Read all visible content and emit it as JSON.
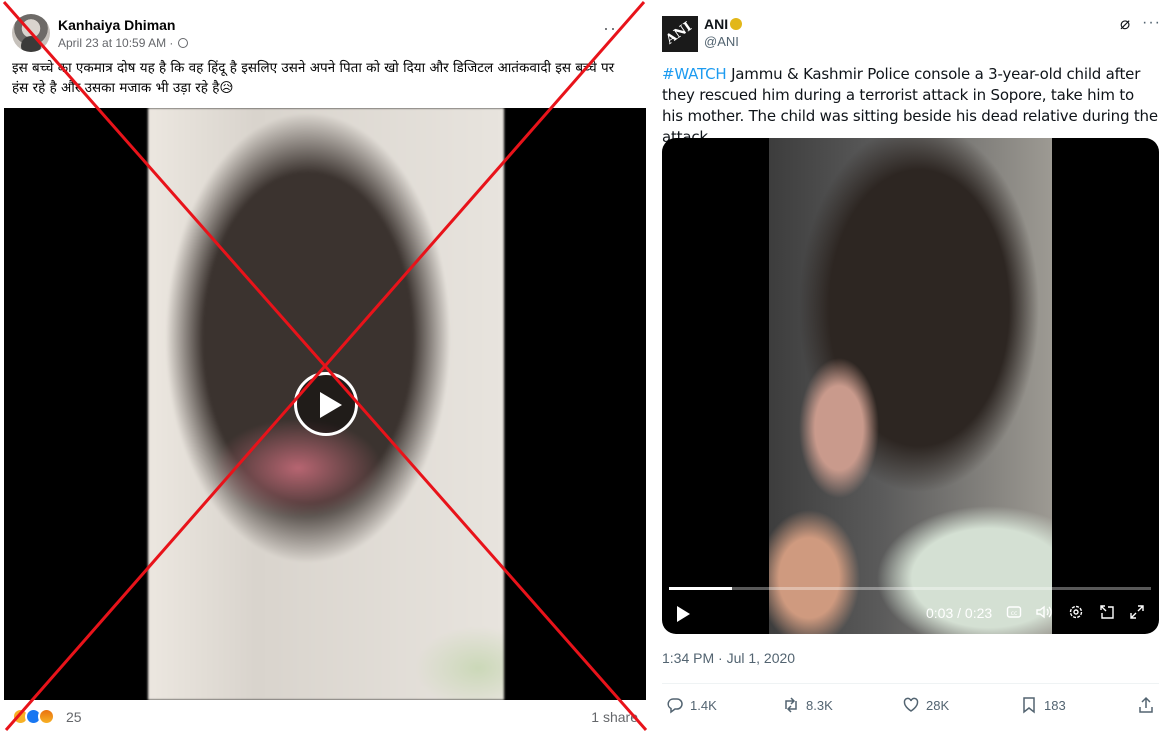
{
  "facebook_post": {
    "author": "Kanhaiya Dhiman",
    "date": "April 23 at 10:59 AM ·",
    "more_label": "···",
    "text": "इस बच्चे का एकमात्र दोष यह है कि वह हिंदू है इसलिए उसने अपने पिता को खो दिया और डिजिटल आतंकवादी इस बच्चे पर हंस रहे है और उसका मजाक भी उड़ा रहे है😥",
    "reaction_count": "25",
    "shares": "1 share",
    "reactions": [
      "care-icon",
      "like-icon",
      "angry-icon"
    ]
  },
  "tweet": {
    "author": "ANI",
    "handle": "@ANI",
    "hashtag": "#WATCH",
    "text": " Jammu & Kashmir Police console a 3-year-old child after they rescued him during a terrorist attack in Sopore, take him to his mother. The child was sitting beside his dead relative during the attack.",
    "video": {
      "time": "0:03 / 0:23",
      "progress": 0.13
    },
    "timestamp": "1:34 PM · Jul 1, 2020",
    "replies": "1.4K",
    "retweets": "8.3K",
    "likes": "28K",
    "bookmarks": "183"
  },
  "colors": {
    "cross": "#e8131a",
    "link": "#1d9bf0",
    "verified": "#e2b719"
  }
}
